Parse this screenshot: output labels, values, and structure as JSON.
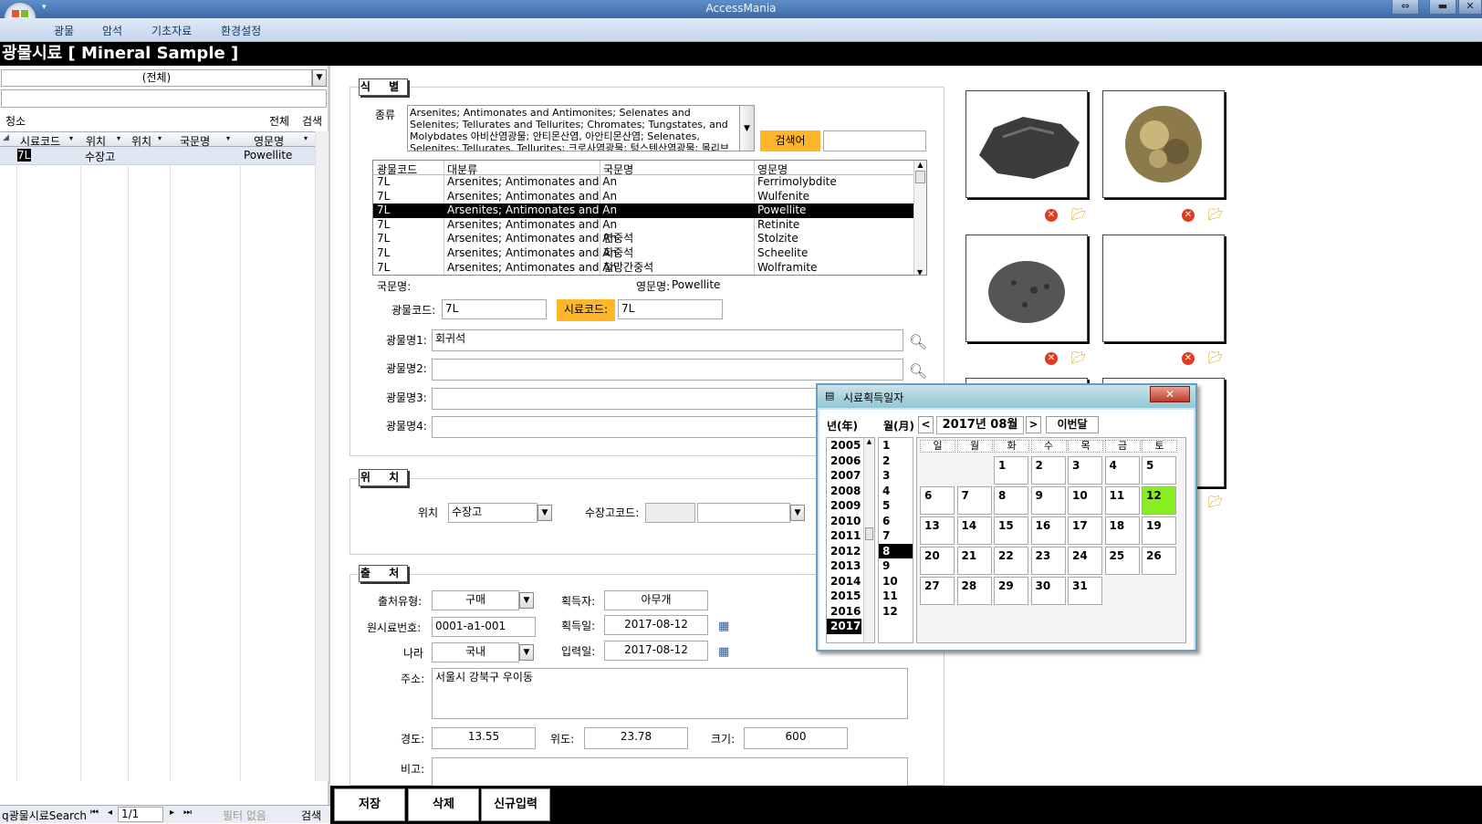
{
  "app": {
    "title": "AccessMania",
    "menu": [
      "광물",
      "암석",
      "기초자료",
      "환경설정"
    ]
  },
  "form": {
    "title": "광물시료 [ Mineral Sample ]"
  },
  "left": {
    "combo": "(전체)",
    "clear": "청소",
    "all": "전체",
    "search": "검색",
    "headers": [
      "시료코드",
      "위치",
      "위치",
      "국문명",
      "영문명"
    ],
    "rows": [
      [
        "7L",
        "수장고",
        "",
        "",
        "Powellite"
      ]
    ],
    "nav": {
      "label": "q광물시료Search",
      "pos": "1/1",
      "filter": "필터 없음",
      "search": "검색"
    }
  },
  "ident": {
    "title": "식 별",
    "type_label": "종류",
    "type_text": "Arsenites; Antimonates and Antimonites; Selenates and Selenites; Tellurates and Tellurites; Chromates; Tungstates, and Molybdates 아비산염광물; 안티몬산염, 아안티몬산염; Selenates, Selenites; Tellurates, Tellurites; 크로사염광물; 텅스텐산염광물; 몰리브덴산염광물",
    "search_kw": "검색어",
    "search_value": "",
    "list_headers": [
      "광물코드",
      "대분류",
      "국문명",
      "영문명"
    ],
    "list_rows": [
      [
        "7L",
        "Arsenites; Antimonates and An",
        "",
        "Ferrimolybdite"
      ],
      [
        "7L",
        "Arsenites; Antimonates and An",
        "",
        "Wulfenite"
      ],
      [
        "7L",
        "Arsenites; Antimonates and An",
        "",
        "Powellite"
      ],
      [
        "7L",
        "Arsenites; Antimonates and An",
        "",
        "Retinite"
      ],
      [
        "7L",
        "Arsenites; Antimonates and An",
        "연중석",
        "Stolzite"
      ],
      [
        "7L",
        "Arsenites; Antimonates and An",
        "회중석",
        "Scheelite"
      ],
      [
        "7L",
        "Arsenites; Antimonates and An",
        "철망간중석",
        "Wolframite"
      ]
    ],
    "kor_label": "국문명:",
    "kor_value": "",
    "eng_label": "영문명:",
    "eng_value": "Powellite",
    "code_label": "광물코드:",
    "code_value": "7L",
    "sample_label": "시료코드:",
    "sample_value": "7L",
    "name1_label": "광물명1:",
    "name1_value": "회귀석",
    "name2_label": "광물명2:",
    "name3_label": "광물명3:",
    "name4_label": "광물명4:"
  },
  "loc": {
    "title": "위 치",
    "loc_label": "위치",
    "loc_value": "수장고",
    "storage_label": "수장고코드:"
  },
  "src": {
    "title": "출 처",
    "type_label": "출처유형:",
    "type_value": "구매",
    "acq_label": "획득자:",
    "acq_value": "아무개",
    "orig_label": "원시료번호:",
    "orig_value": "0001-a1-001",
    "acqdate_label": "획득일:",
    "acqdate_value": "2017-08-12",
    "country_label": "나라",
    "country_value": "국내",
    "inputdate_label": "입력일:",
    "inputdate_value": "2017-08-12",
    "addr_label": "주소:",
    "addr_value": "서울시 강북구 우이동",
    "lon_label": "경도:",
    "lon_value": "13.55",
    "lat_label": "위도:",
    "lat_value": "23.78",
    "size_label": "크기:",
    "size_value": "600",
    "note_label": "비고:"
  },
  "buttons": {
    "save": "저장",
    "delete": "삭제",
    "new": "신규입력"
  },
  "calendar": {
    "title": "시료획득일자",
    "year_label": "년(年)",
    "month_label": "월(月)",
    "current": "2017년 08월",
    "this_month": "이번달",
    "prev": "<",
    "next": ">",
    "years": [
      "2005",
      "2006",
      "2007",
      "2008",
      "2009",
      "2010",
      "2011",
      "2012",
      "2013",
      "2014",
      "2015",
      "2016",
      "2017"
    ],
    "months": [
      "1",
      "2",
      "3",
      "4",
      "5",
      "6",
      "7",
      "8",
      "9",
      "10",
      "11",
      "12"
    ],
    "weekdays": [
      "일",
      "월",
      "화",
      "수",
      "목",
      "금",
      "토"
    ],
    "selected_day": "12",
    "selected_month": "8",
    "selected_year": "2017",
    "first_weekday": 2,
    "days_in_month": 31,
    "highlight_color": "#88ee22"
  }
}
